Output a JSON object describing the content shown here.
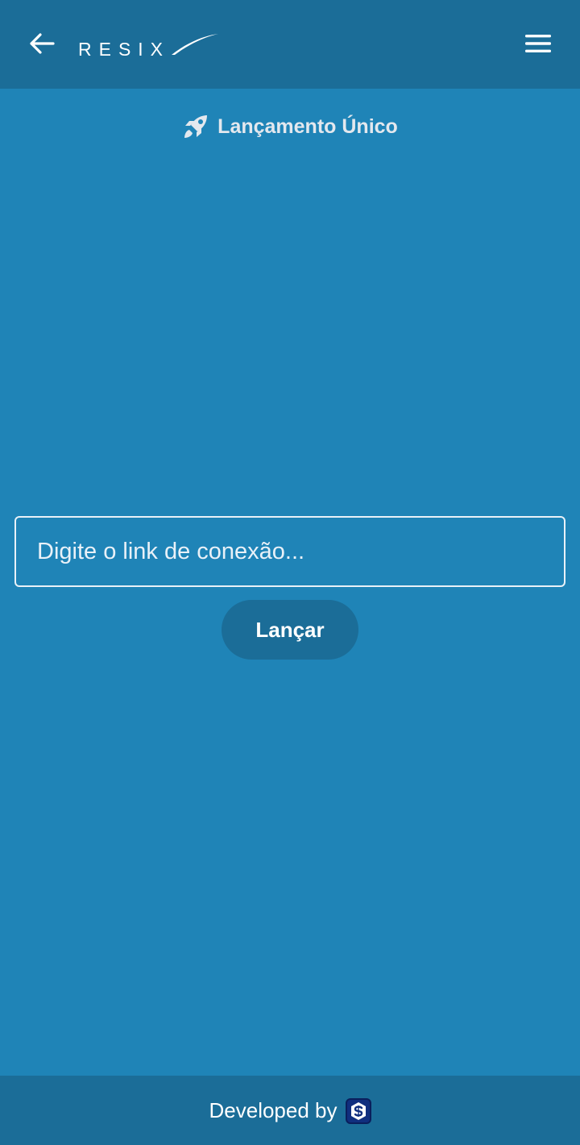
{
  "app": {
    "logo_text": "RESIX"
  },
  "header": {
    "back_icon": "arrow-left-icon",
    "menu_icon": "hamburger-menu-icon"
  },
  "main": {
    "title": "Lançamento Único",
    "title_icon": "rocket-icon",
    "link_input": {
      "value": "",
      "placeholder": "Digite o link de conexão..."
    },
    "launch_label": "Lançar"
  },
  "footer": {
    "text": "Developed by",
    "logo_icon": "s-logo-icon"
  },
  "colors": {
    "bar_bg": "#1b6d98",
    "main_bg": "#1f84b7",
    "button_bg": "#1b6d98",
    "heading": "#e3e8ee"
  }
}
